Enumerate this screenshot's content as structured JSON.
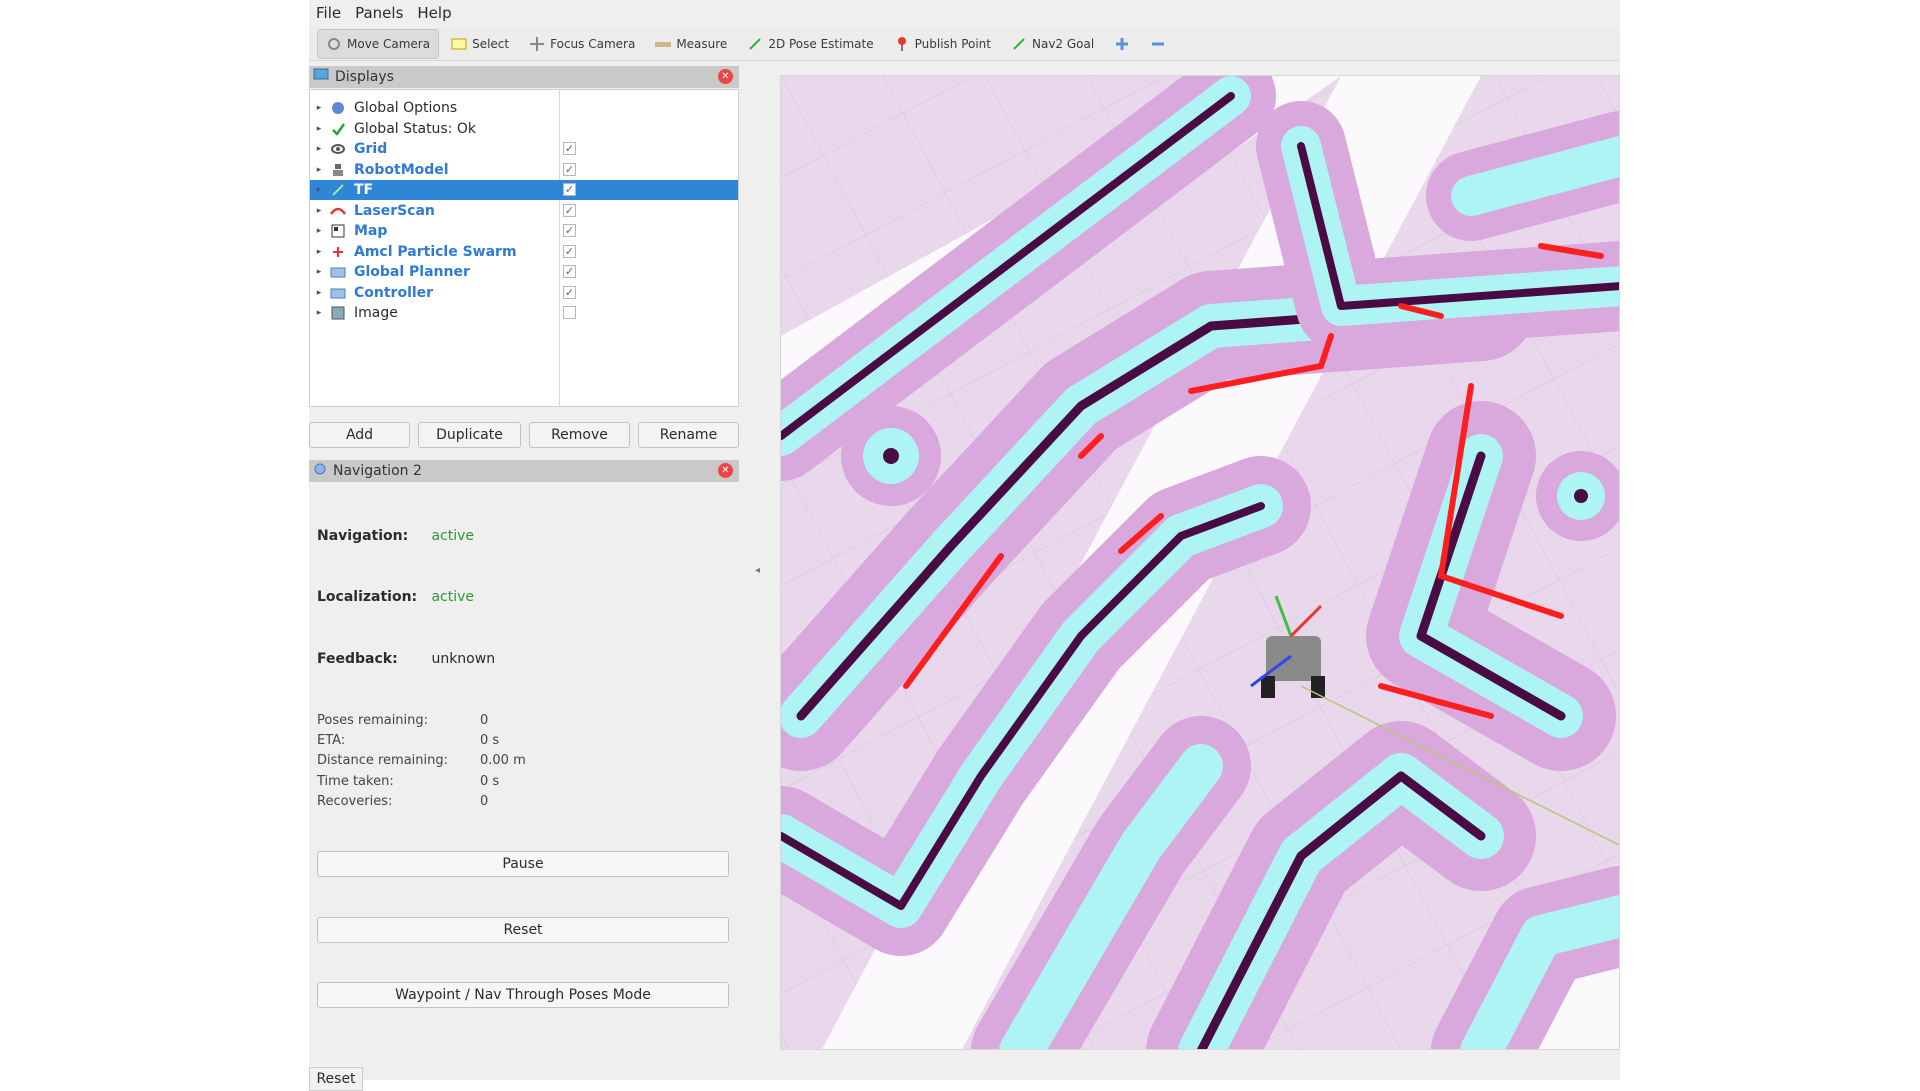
{
  "menu": [
    "File",
    "Panels",
    "Help"
  ],
  "toolbar": [
    {
      "label": "Move Camera",
      "icon": "move-camera-icon",
      "active": true
    },
    {
      "label": "Select",
      "icon": "select-icon"
    },
    {
      "label": "Focus Camera",
      "icon": "focus-camera-icon"
    },
    {
      "label": "Measure",
      "icon": "measure-icon"
    },
    {
      "label": "2D Pose Estimate",
      "icon": "pose-estimate-icon"
    },
    {
      "label": "Publish Point",
      "icon": "publish-point-icon"
    },
    {
      "label": "Nav2 Goal",
      "icon": "nav2-goal-icon"
    }
  ],
  "displays": {
    "title": "Displays",
    "items": [
      {
        "label": "Global Options",
        "icon": "global-options-icon",
        "checkable": false,
        "checked": false,
        "blue": false,
        "selected": false
      },
      {
        "label": "Global Status: Ok",
        "icon": "checkmark-icon",
        "checkable": false,
        "checked": false,
        "blue": false,
        "selected": false
      },
      {
        "label": "Grid",
        "icon": "grid-icon",
        "checkable": true,
        "checked": true,
        "blue": true,
        "selected": false
      },
      {
        "label": "RobotModel",
        "icon": "robot-model-icon",
        "checkable": true,
        "checked": true,
        "blue": true,
        "selected": false
      },
      {
        "label": "TF",
        "icon": "tf-icon",
        "checkable": true,
        "checked": true,
        "blue": true,
        "selected": true
      },
      {
        "label": "LaserScan",
        "icon": "laser-scan-icon",
        "checkable": true,
        "checked": true,
        "blue": true,
        "selected": false
      },
      {
        "label": "Map",
        "icon": "map-icon",
        "checkable": true,
        "checked": true,
        "blue": true,
        "selected": false
      },
      {
        "label": "Amcl Particle Swarm",
        "icon": "particle-swarm-icon",
        "checkable": true,
        "checked": true,
        "blue": true,
        "selected": false
      },
      {
        "label": "Global Planner",
        "icon": "folder-icon",
        "checkable": true,
        "checked": true,
        "blue": true,
        "selected": false
      },
      {
        "label": "Controller",
        "icon": "folder-icon",
        "checkable": true,
        "checked": true,
        "blue": true,
        "selected": false
      },
      {
        "label": "Image",
        "icon": "image-icon",
        "checkable": true,
        "checked": false,
        "blue": false,
        "selected": false
      }
    ],
    "buttons": [
      "Add",
      "Duplicate",
      "Remove",
      "Rename"
    ]
  },
  "nav": {
    "title": "Navigation 2",
    "navigation_label": "Navigation:",
    "navigation_value": "active",
    "localization_label": "Localization:",
    "localization_value": "active",
    "feedback_label": "Feedback:",
    "feedback_value": "unknown",
    "stats": [
      {
        "k": "Poses remaining:",
        "v": "0"
      },
      {
        "k": "ETA:",
        "v": "0 s"
      },
      {
        "k": "Distance remaining:",
        "v": "0.00 m"
      },
      {
        "k": "Time taken:",
        "v": "0 s"
      },
      {
        "k": "Recoveries:",
        "v": "0"
      }
    ],
    "pause_label": "Pause",
    "reset_label": "Reset",
    "mode_label": "Waypoint / Nav Through Poses Mode"
  },
  "bottom_reset": "Reset",
  "colors": {
    "costmap_low": "#e9d7ec",
    "costmap_mid": "#d6a9d8",
    "inflation": "#aef4f4",
    "obstacle": "#4a0b45",
    "laser": "#ff1e1e",
    "selection": "#2f86d6",
    "active_green": "#2e9a2e"
  }
}
